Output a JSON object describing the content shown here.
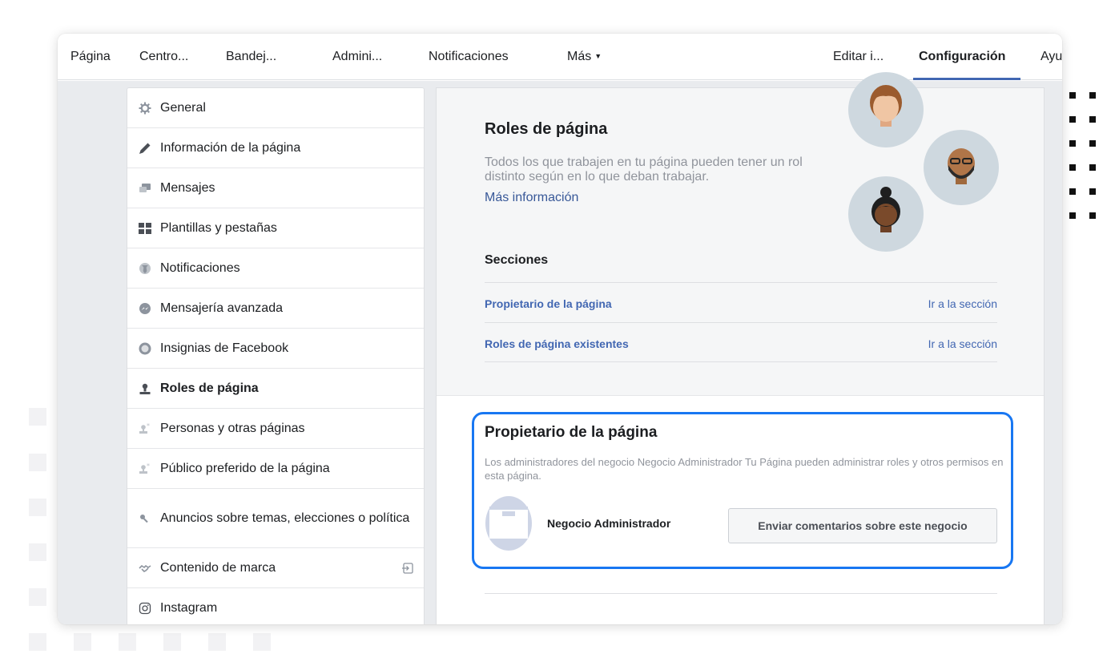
{
  "topnav": {
    "items": [
      {
        "label": "Página"
      },
      {
        "label": "Centro..."
      },
      {
        "label": "Bandej..."
      },
      {
        "label": "Admini..."
      },
      {
        "label": "Notificaciones"
      },
      {
        "label": "Más"
      },
      {
        "label": "Editar i..."
      },
      {
        "label": "Configuración"
      },
      {
        "label": "Ayu"
      }
    ],
    "active": "Configuración"
  },
  "sidebar": {
    "items": [
      {
        "label": "General",
        "icon": "gear-icon"
      },
      {
        "label": "Información de la página",
        "icon": "pencil-icon"
      },
      {
        "label": "Mensajes",
        "icon": "chat-bubbles-icon"
      },
      {
        "label": "Plantillas y pestañas",
        "icon": "grid-icon"
      },
      {
        "label": "Notificaciones",
        "icon": "globe-icon"
      },
      {
        "label": "Mensajería avanzada",
        "icon": "messenger-icon"
      },
      {
        "label": "Insignias de Facebook",
        "icon": "badge-icon"
      },
      {
        "label": "Roles de página",
        "icon": "person-icon"
      },
      {
        "label": "Personas y otras páginas",
        "icon": "person-star-icon"
      },
      {
        "label": "Público preferido de la página",
        "icon": "person-star-icon"
      },
      {
        "label": "Anuncios sobre temas, elecciones o política",
        "icon": "key-icon"
      },
      {
        "label": "Contenido de marca",
        "icon": "handshake-icon"
      },
      {
        "label": "Instagram",
        "icon": "instagram-icon"
      }
    ],
    "active": "Roles de página"
  },
  "roles": {
    "title": "Roles de página",
    "description": "Todos los que trabajen en tu página pueden tener un rol distinto según en lo que deban trabajar.",
    "more_link": "Más información",
    "sections_title": "Secciones",
    "sections": [
      {
        "name": "Propietario de la página",
        "action": "Ir a la sección"
      },
      {
        "name": "Roles de página existentes",
        "action": "Ir a la sección"
      }
    ]
  },
  "owner": {
    "title": "Propietario de la página",
    "description": "Los administradores del negocio  Negocio Administrador Tu Página  pueden administrar roles y otros permisos en esta página.",
    "business_name": "Negocio Administrador",
    "feedback_button": "Enviar comentarios sobre este negocio"
  },
  "colors": {
    "link": "#4267b2",
    "highlight_border": "#1877f2",
    "page_bg": "#e9ebee"
  }
}
